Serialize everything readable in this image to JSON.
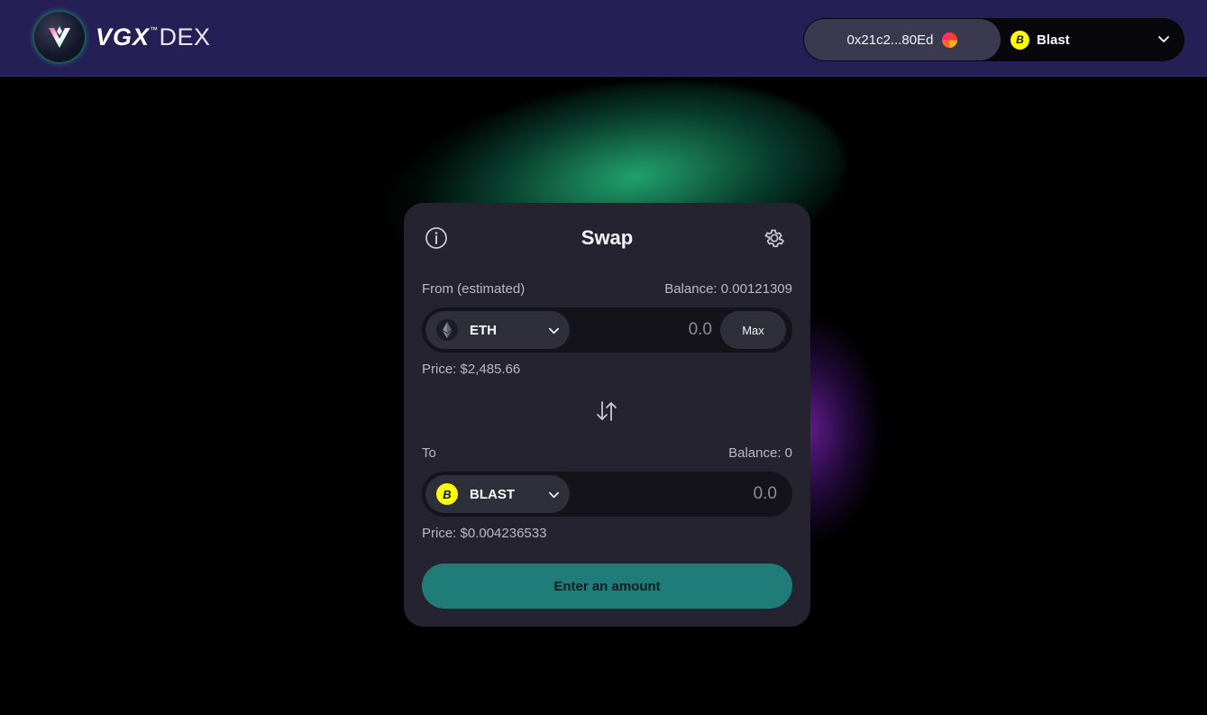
{
  "header": {
    "logo_brand": "VGX",
    "logo_tm": "™",
    "logo_product": "DEX",
    "wallet_address": "0x21c2...80Ed",
    "network_name": "Blast",
    "network_icon": "blast-icon",
    "network_icon_color": "#fcfc03"
  },
  "swap": {
    "title": "Swap",
    "from": {
      "label": "From (estimated)",
      "balance": "Balance: 0.00121309",
      "token": "ETH",
      "token_icon": "eth-icon",
      "amount_placeholder": "0.0",
      "max_label": "Max",
      "price": "Price: $2,485.66"
    },
    "to": {
      "label": "To",
      "balance": "Balance: 0",
      "token": "BLAST",
      "token_icon": "blast-icon",
      "amount_placeholder": "0.0",
      "price": "Price: $0.004236533"
    },
    "submit_label": "Enter an amount"
  },
  "colors": {
    "header_bg": "#241f54",
    "card_bg": "#24232f",
    "accent": "#1f7c78"
  }
}
